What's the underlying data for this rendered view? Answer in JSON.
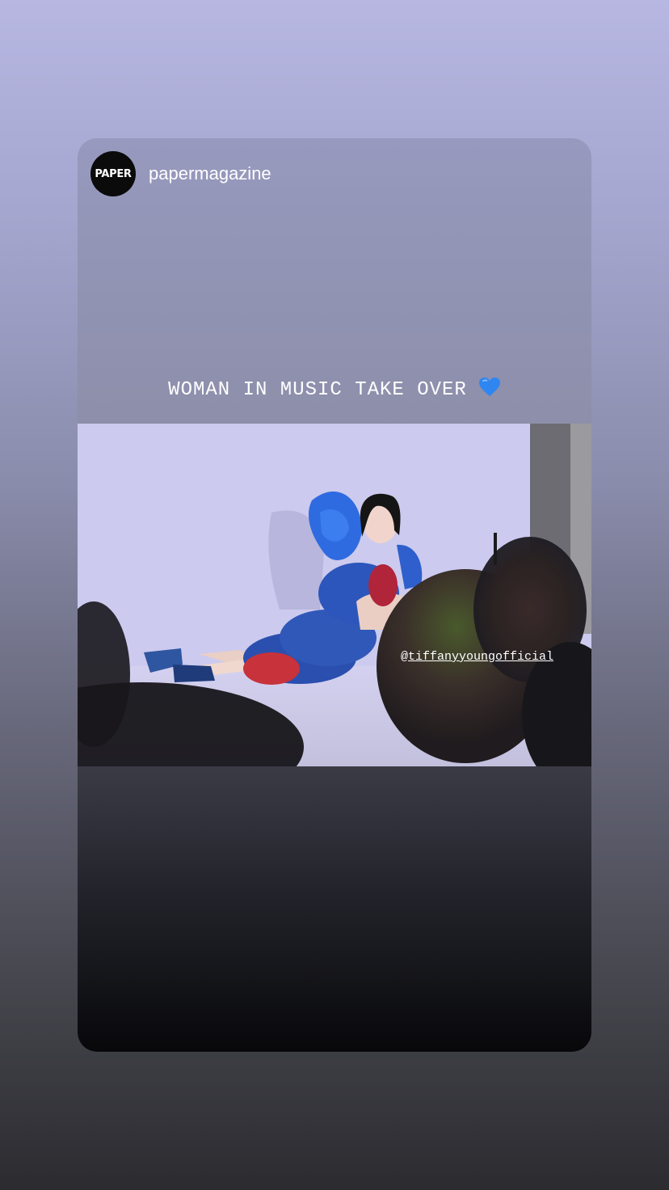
{
  "story": {
    "avatar_text": "PAPER",
    "username": "papermagazine",
    "caption": "WOMAN IN MUSIC TAKE OVER",
    "caption_emoji": "blue-heart-icon",
    "mention_prefix": "@",
    "mention_handle": "tiffanyyoungofficial"
  },
  "colors": {
    "heart": "#2f86f0",
    "avatar_bg": "#0b0b0b"
  }
}
